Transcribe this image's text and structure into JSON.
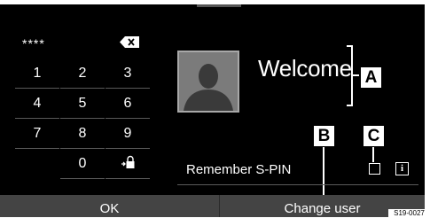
{
  "pin": {
    "masked_value": "****",
    "backspace_icon": "backspace-icon",
    "keys": [
      {
        "label": "1"
      },
      {
        "label": "2"
      },
      {
        "label": "3"
      },
      {
        "label": "4"
      },
      {
        "label": "5"
      },
      {
        "label": "6"
      },
      {
        "label": "7"
      },
      {
        "label": "8"
      },
      {
        "label": "9"
      },
      {
        "label": "0"
      }
    ],
    "lock_key_icon": "lock-key-icon"
  },
  "user": {
    "avatar_icon": "user-avatar-icon",
    "welcome_text": "Welcome"
  },
  "options": {
    "remember_label": "Remember S-PIN",
    "remember_checked": false,
    "info_label": "i"
  },
  "bottom_bar": {
    "ok_label": "OK",
    "change_user_label": "Change user"
  },
  "callouts": {
    "a": "A",
    "b": "B",
    "c": "C"
  },
  "figure_id": "S19-0027",
  "colors": {
    "screen_background": "#000000",
    "bottom_bar": "#444444",
    "avatar_background": "#7b7b7b",
    "text": "#ffffff"
  }
}
